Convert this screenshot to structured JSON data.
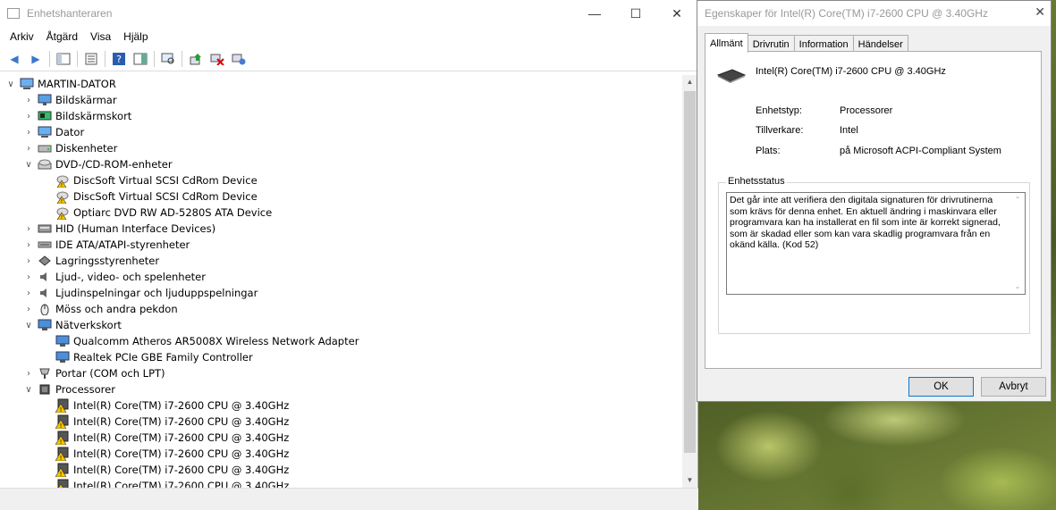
{
  "device_manager": {
    "title": "Enhetshanteraren",
    "menu": [
      "Arkiv",
      "Åtgärd",
      "Visa",
      "Hjälp"
    ],
    "tree": {
      "root": "MARTIN-DATOR",
      "categories": [
        {
          "label": "Bildskärmar",
          "expanded": false,
          "icon": "monitor-icon"
        },
        {
          "label": "Bildskärmskort",
          "expanded": false,
          "icon": "display-adapter-icon"
        },
        {
          "label": "Dator",
          "expanded": false,
          "icon": "computer-icon"
        },
        {
          "label": "Diskenheter",
          "expanded": false,
          "icon": "disk-icon"
        },
        {
          "label": "DVD-/CD-ROM-enheter",
          "expanded": true,
          "icon": "dvd-icon",
          "children": [
            "DiscSoft Virtual SCSI CdRom Device",
            "DiscSoft Virtual SCSI CdRom Device",
            "Optiarc DVD RW AD-5280S ATA Device"
          ]
        },
        {
          "label": "HID (Human Interface Devices)",
          "expanded": false,
          "icon": "hid-icon"
        },
        {
          "label": "IDE ATA/ATAPI-styrenheter",
          "expanded": false,
          "icon": "ide-icon"
        },
        {
          "label": "Lagringsstyrenheter",
          "expanded": false,
          "icon": "storage-icon"
        },
        {
          "label": "Ljud-, video- och spelenheter",
          "expanded": false,
          "icon": "speaker-icon"
        },
        {
          "label": "Ljudinspelningar och ljuduppspelningar",
          "expanded": false,
          "icon": "speaker-icon"
        },
        {
          "label": "Möss och andra pekdon",
          "expanded": false,
          "icon": "mouse-icon"
        },
        {
          "label": "Nätverkskort",
          "expanded": true,
          "icon": "network-icon",
          "children": [
            "Qualcomm Atheros AR5008X Wireless Network Adapter",
            "Realtek PCIe GBE Family Controller"
          ]
        },
        {
          "label": "Portar (COM och LPT)",
          "expanded": false,
          "icon": "port-icon"
        },
        {
          "label": "Processorer",
          "expanded": true,
          "icon": "processor-icon",
          "children": [
            "Intel(R) Core(TM) i7-2600 CPU @ 3.40GHz",
            "Intel(R) Core(TM) i7-2600 CPU @ 3.40GHz",
            "Intel(R) Core(TM) i7-2600 CPU @ 3.40GHz",
            "Intel(R) Core(TM) i7-2600 CPU @ 3.40GHz",
            "Intel(R) Core(TM) i7-2600 CPU @ 3.40GHz",
            "Intel(R) Core(TM) i7-2600 CPU @ 3.40GHz"
          ]
        }
      ]
    }
  },
  "properties": {
    "title": "Egenskaper för Intel(R) Core(TM) i7-2600 CPU @ 3.40GHz",
    "tabs": [
      "Allmänt",
      "Drivrutin",
      "Information",
      "Händelser"
    ],
    "active_tab": "Allmänt",
    "device_name": "Intel(R) Core(TM) i7-2600 CPU @ 3.40GHz",
    "fields": [
      {
        "label": "Enhetstyp:",
        "value": "Processorer"
      },
      {
        "label": "Tillverkare:",
        "value": "Intel"
      },
      {
        "label": "Plats:",
        "value": "på Microsoft ACPI-Compliant System"
      }
    ],
    "status_legend": "Enhetsstatus",
    "status_text": "Det går inte att verifiera den digitala signaturen för drivrutinerna som krävs för denna enhet. En aktuell ändring i maskinvara eller programvara kan ha installerat en fil som inte är korrekt signerad, som är skadad eller som kan vara skadlig programvara från en okänd källa. (Kod 52)",
    "ok_label": "OK",
    "cancel_label": "Avbryt"
  }
}
